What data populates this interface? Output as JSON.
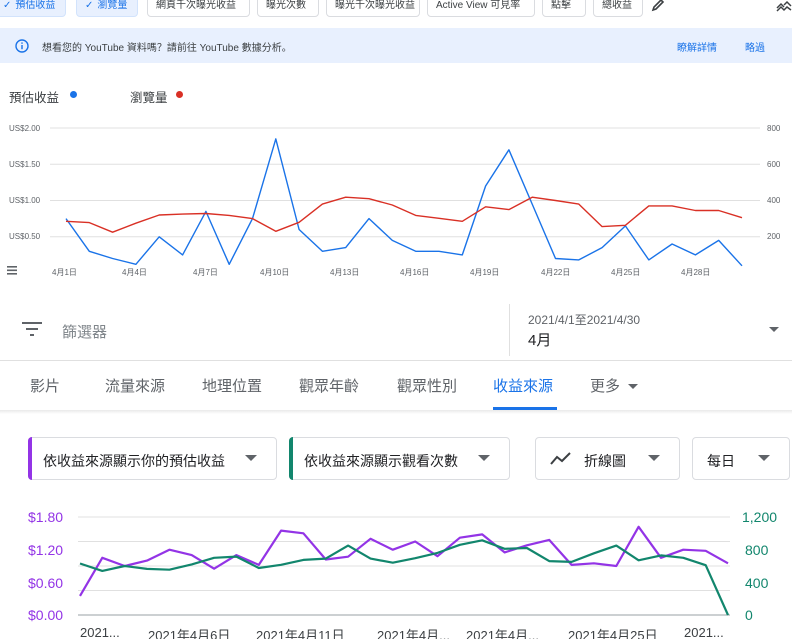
{
  "metric_chips": [
    {
      "label": "預估收益",
      "selected": true
    },
    {
      "label": "瀏覽量",
      "selected": true
    },
    {
      "label": "網頁千次曝光收益",
      "selected": false
    },
    {
      "label": "曝光次數",
      "selected": false
    },
    {
      "label": "曝光千次曝光收益",
      "selected": false
    },
    {
      "label": "Active View 可見率",
      "selected": false
    },
    {
      "label": "點擊",
      "selected": false
    },
    {
      "label": "總收益",
      "selected": false
    }
  ],
  "toolbar": {
    "check_glyph": "✓",
    "edit_icon": "pencil-icon",
    "collapse_icon": "collapse-arrows-icon"
  },
  "banner": {
    "message": "想看您的 YouTube 資料嗎？請前往 YouTube 數據分析。",
    "learn_more": "瞭解詳情",
    "skip": "略過"
  },
  "overview_chart_legend": {
    "revenue_label": "預估收益",
    "pageviews_label": "瀏覽量",
    "revenue_color": "#1a73e8",
    "pageviews_color": "#d93025"
  },
  "colors": {
    "accent": "#1a73e8",
    "revenue_purple": "#9334e6",
    "views_green": "#12866d"
  },
  "chart_data": [
    {
      "type": "line",
      "title": "",
      "x": [
        "4月1日",
        "4月2日",
        "4月3日",
        "4月4日",
        "4月5日",
        "4月6日",
        "4月7日",
        "4月8日",
        "4月9日",
        "4月10日",
        "4月11日",
        "4月12日",
        "4月13日",
        "4月14日",
        "4月15日",
        "4月16日",
        "4月17日",
        "4月18日",
        "4月19日",
        "4月20日",
        "4月21日",
        "4月22日",
        "4月23日",
        "4月24日",
        "4月25日",
        "4月26日",
        "4月27日",
        "4月28日",
        "4月29日",
        "4月30日"
      ],
      "x_tick_labels": [
        "4月1日",
        "4月4日",
        "4月7日",
        "4月10日",
        "4月13日",
        "4月16日",
        "4月19日",
        "4月22日",
        "4月25日",
        "4月28日"
      ],
      "series": [
        {
          "name": "預估收益",
          "axis": "left",
          "color": "#1a73e8",
          "values": [
            0.75,
            0.3,
            0.2,
            0.12,
            0.5,
            0.25,
            0.85,
            0.12,
            0.75,
            1.85,
            0.6,
            0.3,
            0.35,
            0.75,
            0.45,
            0.3,
            0.3,
            0.25,
            1.2,
            1.7,
            0.95,
            0.2,
            0.18,
            0.35,
            0.65,
            0.18,
            0.4,
            0.25,
            0.45,
            0.1
          ]
        },
        {
          "name": "瀏覽量",
          "axis": "right",
          "color": "#d93025",
          "values": [
            285,
            278,
            225,
            275,
            320,
            325,
            328,
            318,
            300,
            230,
            280,
            380,
            418,
            410,
            375,
            318,
            302,
            285,
            365,
            350,
            418,
            400,
            380,
            256,
            263,
            370,
            370,
            345,
            345,
            305
          ]
        }
      ],
      "left_axis": {
        "ticks": [
          "US$0.50",
          "US$1.00",
          "US$1.50",
          "US$2.00"
        ],
        "ylim": [
          0.0,
          2.0
        ]
      },
      "right_axis": {
        "ticks": [
          "200",
          "400",
          "600",
          "800"
        ],
        "ylim": [
          0,
          800
        ]
      },
      "grid": true
    },
    {
      "type": "line",
      "title": "",
      "x": [
        "2021年4月1日",
        "2021年4月2日",
        "2021年4月3日",
        "2021年4月4日",
        "2021年4月5日",
        "2021年4月6日",
        "2021年4月7日",
        "2021年4月8日",
        "2021年4月9日",
        "2021年4月10日",
        "2021年4月11日",
        "2021年4月12日",
        "2021年4月13日",
        "2021年4月14日",
        "2021年4月15日",
        "2021年4月16日",
        "2021年4月17日",
        "2021年4月18日",
        "2021年4月19日",
        "2021年4月20日",
        "2021年4月21日",
        "2021年4月22日",
        "2021年4月23日",
        "2021年4月24日",
        "2021年4月25日",
        "2021年4月26日",
        "2021年4月27日",
        "2021年4月28日",
        "2021年4月29日",
        "2021年4月30日"
      ],
      "x_tick_labels": [
        "2021...",
        "2021年4月6日",
        "2021年4月11日",
        "2021年4月...",
        "2021年4月...",
        "2021年4月25日",
        "2021..."
      ],
      "series": [
        {
          "name": "依收益來源顯示你的預估收益",
          "axis": "left",
          "color": "#9334e6",
          "values": [
            0.35,
            1.05,
            0.9,
            1.0,
            1.2,
            1.1,
            0.85,
            1.1,
            0.92,
            1.55,
            1.5,
            1.02,
            1.07,
            1.4,
            1.2,
            1.35,
            1.08,
            1.42,
            1.48,
            1.15,
            1.28,
            1.38,
            0.92,
            0.95,
            0.9,
            1.62,
            1.05,
            1.2,
            1.18,
            0.95
          ]
        },
        {
          "name": "依收益來源顯示觀看次數",
          "axis": "right",
          "color": "#12866d",
          "values": [
            630,
            540,
            600,
            565,
            555,
            620,
            700,
            715,
            575,
            615,
            675,
            690,
            850,
            690,
            640,
            695,
            760,
            860,
            915,
            810,
            820,
            660,
            650,
            755,
            850,
            670,
            730,
            700,
            610,
            0
          ]
        }
      ],
      "left_axis": {
        "ticks": [
          "$0.00",
          "$0.60",
          "$1.20",
          "$1.80"
        ],
        "ylim": [
          0.0,
          1.8
        ]
      },
      "right_axis": {
        "ticks": [
          "0",
          "400",
          "800",
          "1,200"
        ],
        "ylim": [
          0,
          1200
        ]
      },
      "grid": true
    }
  ],
  "filter": {
    "icon": "filter-icon",
    "label": "篩選器"
  },
  "date": {
    "range": "2021/4/1至2021/4/30",
    "selected": "4月"
  },
  "tabs": [
    {
      "label": "影片",
      "active": false
    },
    {
      "label": "流量來源",
      "active": false
    },
    {
      "label": "地理位置",
      "active": false
    },
    {
      "label": "觀眾年齡",
      "active": false
    },
    {
      "label": "觀眾性別",
      "active": false
    },
    {
      "label": "收益來源",
      "active": true
    },
    {
      "label": "更多",
      "active": false
    }
  ],
  "dropdowns": {
    "metric_a": "依收益來源顯示你的預估收益",
    "metric_b": "依收益來源顯示觀看次數",
    "chart_type": "折線圖",
    "granularity": "每日"
  }
}
